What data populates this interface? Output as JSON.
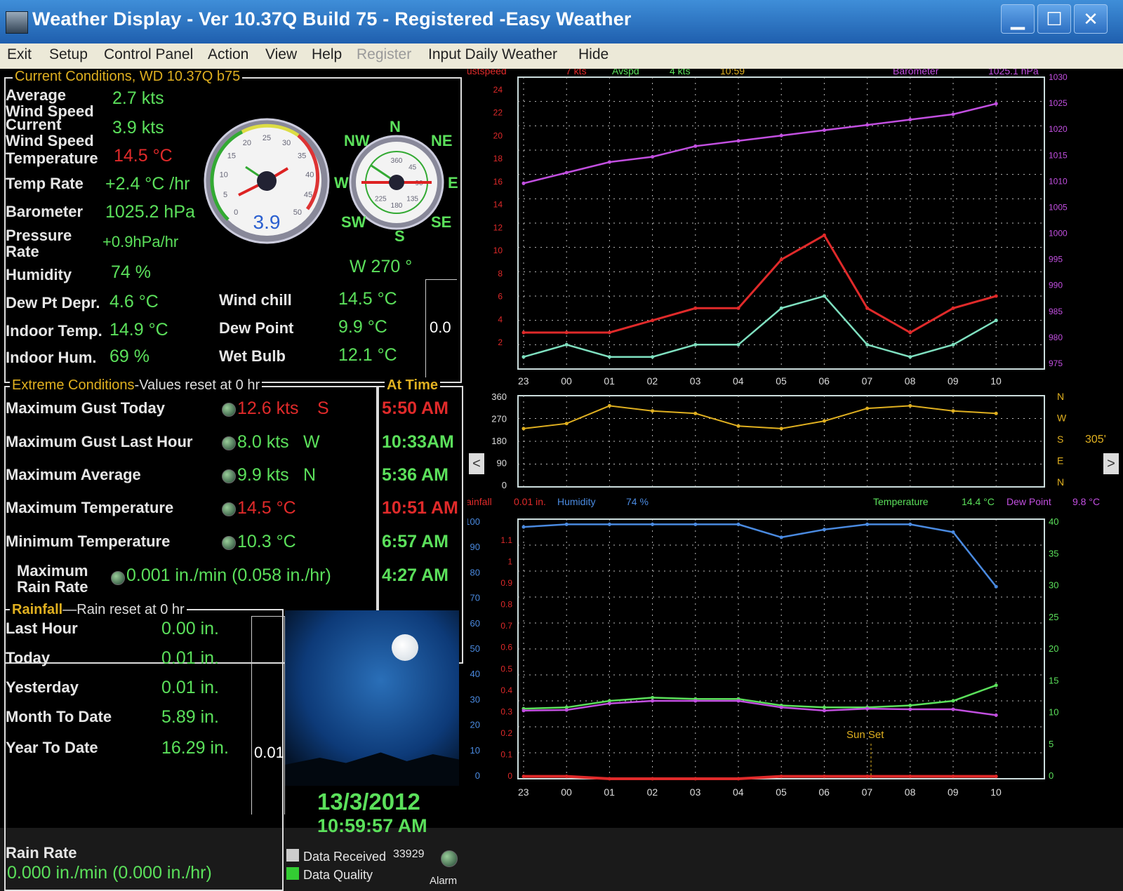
{
  "window": {
    "title": "Weather Display - Ver 10.37Q Build 75 - Registered  -Easy Weather",
    "minimize": "▁",
    "maximize": "☐",
    "close": "✕"
  },
  "menu": [
    "Exit",
    "Setup",
    "Control Panel",
    "Action",
    "View",
    "Help",
    "Register",
    "Input Daily Weather",
    "Hide"
  ],
  "current": {
    "header": "Current Conditions, WD 10.37Q b75",
    "avg_wind_label": "Average\nWind Speed",
    "avg_wind": "2.7 kts",
    "cur_wind_label": "Current\nWind Speed",
    "cur_wind": "3.9 kts",
    "temp_label": "Temperature",
    "temp": "14.5 °C",
    "temp_rate_label": "Temp Rate",
    "temp_rate": "+2.4 °C /hr",
    "baro_label": "Barometer",
    "baro": "1025.2 hPa",
    "pressure_rate_label": "Pressure\nRate",
    "pressure_rate": "+0.9hPa/hr",
    "humidity_label": "Humidity",
    "humidity": "74 %",
    "dewdepr_label": "Dew Pt Depr.",
    "dewdepr": "4.6 °C",
    "indoor_temp_label": "Indoor Temp.",
    "indoor_temp": "14.9 °C",
    "indoor_hum_label": "Indoor Hum.",
    "indoor_hum": "69 %",
    "windchill_label": "Wind chill",
    "windchill": "14.5 °C",
    "dewpoint_label": "Dew Point",
    "dewpoint": "9.9 °C",
    "wetbulb_label": "Wet Bulb",
    "wetbulb": "12.1 °C",
    "side_value": "0.0",
    "speed_gauge": {
      "value": "3.9",
      "ticks": [
        "0",
        "5",
        "10",
        "15",
        "20",
        "25",
        "30",
        "35",
        "40",
        "45",
        "50"
      ]
    },
    "compass": {
      "N": "N",
      "NE": "NE",
      "E": "E",
      "SE": "SE",
      "S": "S",
      "SW": "SW",
      "W": "W",
      "NW": "NW",
      "ticks": [
        "360",
        "45",
        "90",
        "135",
        "180",
        "225"
      ],
      "direction": "W  270 °"
    }
  },
  "extreme": {
    "header": "Extreme Conditions",
    "reset_note": "-Values reset at 0 hr",
    "time_header": "At Time",
    "rows": [
      {
        "label": "Maximum Gust Today",
        "value": "12.6 kts",
        "dir": "S",
        "time": "5:50 AM",
        "color": "red"
      },
      {
        "label": "Maximum Gust Last Hour",
        "value": "8.0 kts",
        "dir": "W",
        "time": "10:33AM",
        "color": "green"
      },
      {
        "label": "Maximum Average",
        "value": "9.9 kts",
        "dir": "N",
        "time": "5:36 AM",
        "color": "green"
      },
      {
        "label": "Maximum Temperature",
        "value": "14.5 °C",
        "dir": "",
        "time": "10:51 AM",
        "color": "red"
      },
      {
        "label": "Minimum Temperature",
        "value": "10.3 °C",
        "dir": "",
        "time": "6:57 AM",
        "color": "green"
      },
      {
        "label": "Maximum\nRain Rate",
        "value": "0.001 in./min (0.058 in./hr)",
        "dir": "",
        "time": "4:27 AM",
        "color": "green"
      }
    ]
  },
  "rainfall": {
    "header": "Rainfall",
    "reset_note": "Rain reset at 0 hr",
    "rows": [
      {
        "label": "Last Hour",
        "value": "0.00 in."
      },
      {
        "label": "Today",
        "value": "0.01 in."
      },
      {
        "label": "Yesterday",
        "value": "0.01 in."
      },
      {
        "label": "Month To Date",
        "value": "5.89 in."
      },
      {
        "label": "Year To Date",
        "value": "16.29 in."
      }
    ],
    "rate_label": "Rain Rate",
    "rate": "0.000 in./min (0.000 in./hr)",
    "gauge_value": "0.01"
  },
  "clock": {
    "date": "13/3/2012",
    "time": "10:59:57 AM"
  },
  "status": {
    "data_received_label": "Data Received",
    "data_received": "33929",
    "data_quality_label": "Data Quality",
    "alarm_label": "Alarm"
  },
  "colors": {
    "green": "#5be05b",
    "red": "#e02a2a",
    "yellow": "#e0b020",
    "purple": "#c24fe0",
    "blue": "#4a8ae0",
    "panel": "#000000"
  },
  "charts": {
    "hours": [
      "23",
      "00",
      "01",
      "02",
      "03",
      "04",
      "05",
      "06",
      "07",
      "08",
      "09",
      "10"
    ],
    "wind": {
      "legend": [
        {
          "text": "Gustspeed",
          "color": "#e02a2a"
        },
        {
          "text": "7 kts",
          "color": "#e02a2a"
        },
        {
          "text": "Avspd",
          "color": "#5be05b"
        },
        {
          "text": "4 kts",
          "color": "#5be05b"
        },
        {
          "text": "10:59",
          "color": "#e0b020"
        },
        {
          "text": "Barometer",
          "color": "#c24fe0"
        },
        {
          "text": "1025.1 hPa",
          "color": "#c24fe0"
        }
      ],
      "left_ticks": [
        "24",
        "22",
        "20",
        "18",
        "16",
        "14",
        "12",
        "10",
        "8",
        "6",
        "4",
        "2"
      ],
      "right_ticks": [
        "1030",
        "1025",
        "1020",
        "1015",
        "1010",
        "1005",
        "1000",
        "995",
        "990",
        "985",
        "980",
        "975"
      ]
    },
    "direction": {
      "left_ticks": [
        "360",
        "270",
        "180",
        "90",
        "0"
      ],
      "right_ticks": [
        "N",
        "W",
        "S",
        "E",
        "N"
      ],
      "side_value": "305'",
      "prev": "<",
      "next": ">"
    },
    "temp": {
      "legend": [
        {
          "text": "Rainfall",
          "color": "#e02a2a"
        },
        {
          "text": "0.01 in.",
          "color": "#e02a2a"
        },
        {
          "text": "Humidity",
          "color": "#4a8ae0"
        },
        {
          "text": "74 %",
          "color": "#4a8ae0"
        },
        {
          "text": "Temperature",
          "color": "#5be05b"
        },
        {
          "text": "14.4 °C",
          "color": "#5be05b"
        },
        {
          "text": "Dew Point",
          "color": "#c24fe0"
        },
        {
          "text": "9.8 °C",
          "color": "#c24fe0"
        }
      ],
      "hum_ticks": [
        "100",
        "90",
        "80",
        "70",
        "60",
        "50",
        "40",
        "30",
        "20",
        "10",
        "0"
      ],
      "rain_ticks": [
        "1.1",
        "1",
        "0.9",
        "0.8",
        "0.7",
        "0.6",
        "0.5",
        "0.4",
        "0.3",
        "0.2",
        "0.1",
        "0"
      ],
      "temp_ticks": [
        "40",
        "35",
        "30",
        "25",
        "20",
        "15",
        "10",
        "5",
        "0"
      ],
      "annotation": "Sun Set"
    }
  },
  "chart_data": [
    {
      "type": "line",
      "title": "",
      "x": [
        23,
        0,
        1,
        2,
        3,
        4,
        5,
        6,
        7,
        8,
        9,
        10
      ],
      "series": [
        {
          "name": "Gustspeed",
          "axis": "left (kts)",
          "values": [
            3,
            3,
            3,
            4,
            5,
            5,
            9,
            11,
            5,
            3,
            5,
            6
          ]
        },
        {
          "name": "Avspd",
          "axis": "left (kts)",
          "values": [
            1,
            2,
            1,
            1,
            2,
            2,
            5,
            6,
            2,
            1,
            2,
            4
          ]
        },
        {
          "name": "Barometer",
          "axis": "right (hPa)",
          "values": [
            1010,
            1012,
            1014,
            1015,
            1017,
            1018,
            1019,
            1020,
            1021,
            1022,
            1023,
            1025
          ]
        }
      ],
      "ylim_left": [
        0,
        24
      ],
      "ylim_right": [
        975,
        1030
      ]
    },
    {
      "type": "line",
      "title": "",
      "x": [
        23,
        0,
        1,
        2,
        3,
        4,
        5,
        6,
        7,
        8,
        9,
        10
      ],
      "series": [
        {
          "name": "",
          "values": [
            230,
            250,
            320,
            300,
            290,
            240,
            230,
            260,
            310,
            320,
            300,
            290
          ]
        }
      ],
      "ylim": [
        0,
        360
      ]
    },
    {
      "type": "line",
      "title": "",
      "x": [
        23,
        0,
        1,
        2,
        3,
        4,
        5,
        6,
        7,
        8,
        9,
        10
      ],
      "series": [
        {
          "name": "Humidity",
          "axis": "left (%)",
          "values": [
            97,
            98,
            98,
            98,
            98,
            98,
            93,
            96,
            98,
            98,
            95,
            74
          ]
        },
        {
          "name": "Temperature",
          "axis": "right (°C)",
          "values": [
            10.8,
            11,
            12,
            12.5,
            12.3,
            12.3,
            11.3,
            11,
            11,
            11.3,
            12,
            14.4
          ]
        },
        {
          "name": "Dew Point",
          "axis": "right (°C)",
          "values": [
            10.5,
            10.6,
            11.6,
            12,
            12,
            12,
            11,
            10.5,
            10.8,
            10.7,
            10.7,
            9.8
          ]
        },
        {
          "name": "Rainfall",
          "axis": "rain (in.)",
          "values": [
            0.01,
            0.01,
            0,
            0,
            0,
            0,
            0.01,
            0.01,
            0.01,
            0.01,
            0.01,
            0.01
          ]
        }
      ],
      "ylim_left": [
        0,
        100
      ],
      "ylim_right": [
        0,
        40
      ],
      "ylim_rain": [
        0,
        1.1
      ]
    }
  ]
}
